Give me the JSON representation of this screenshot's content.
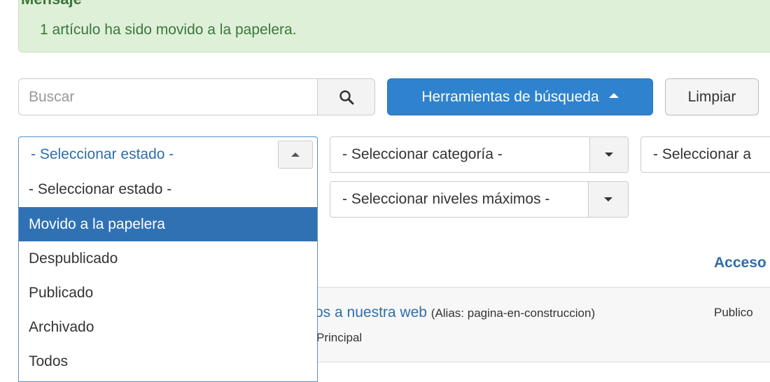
{
  "alert": {
    "heading": "Mensaje",
    "message": "1 artículo ha sido movido a la papelera."
  },
  "search": {
    "placeholder": "Buscar",
    "button_icon": "search-icon",
    "tools_label": "Herramientas de búsqueda",
    "clear_label": "Limpiar"
  },
  "filters": {
    "status": "- Seleccionar estado -",
    "category": "- Seleccionar categoría -",
    "access": "- Seleccionar a",
    "levels": "- Seleccionar niveles máximos -"
  },
  "status_options": [
    "- Seleccionar estado -",
    "Movido a la papelera",
    "Despublicado",
    "Publicado",
    "Archivado",
    "Todos"
  ],
  "table": {
    "access_header": "Acceso",
    "row": {
      "title": "os a nuestra web",
      "alias": "(Alias: pagina-en-construccion)",
      "category": "Principal",
      "access": "Publico"
    }
  },
  "colors": {
    "primary": "#2f82ce",
    "selected": "#3071b4",
    "alert_bg": "#dff0d8",
    "alert_text": "#3c763d",
    "link": "#2f6ea8"
  }
}
